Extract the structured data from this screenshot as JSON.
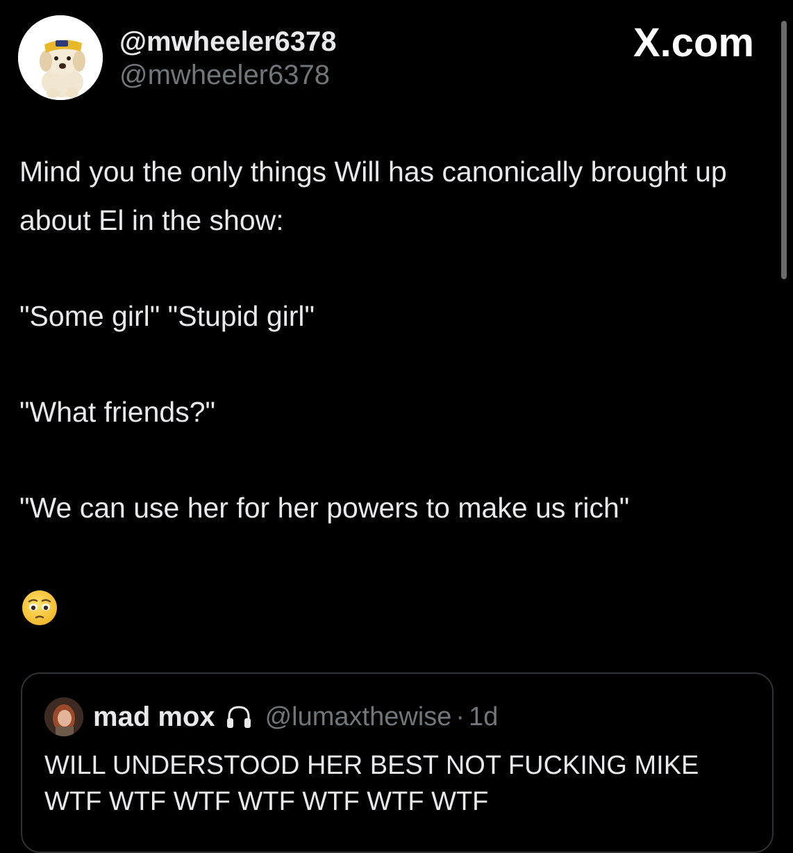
{
  "author": {
    "display_name": "@mwheeler6378",
    "handle": "@mwheeler6378",
    "avatar_icon": "puppy-avatar"
  },
  "site_mark": "X.com",
  "tweet": {
    "lines": [
      "Mind you the only things Will has canonically brought up about El in the show:",
      "\"Some girl\" \"Stupid girl\"",
      "\"What friends?\"",
      "\"We can use her for her powers to make us rich\""
    ],
    "emoji": "pleading-face-emoji"
  },
  "quoted_tweet": {
    "display_name": "mad mox",
    "badge_icon": "headphones-icon",
    "handle": "@lumaxthewise",
    "separator": "·",
    "time": "1d",
    "text_lines": [
      "WILL UNDERSTOOD HER BEST NOT FUCKING MIKE",
      "WTF WTF WTF WTF WTF WTF WTF"
    ]
  },
  "colors": {
    "background": "#000000",
    "primary_text": "#e7e9ea",
    "secondary_text": "#71767b",
    "border": "#2f3336"
  }
}
